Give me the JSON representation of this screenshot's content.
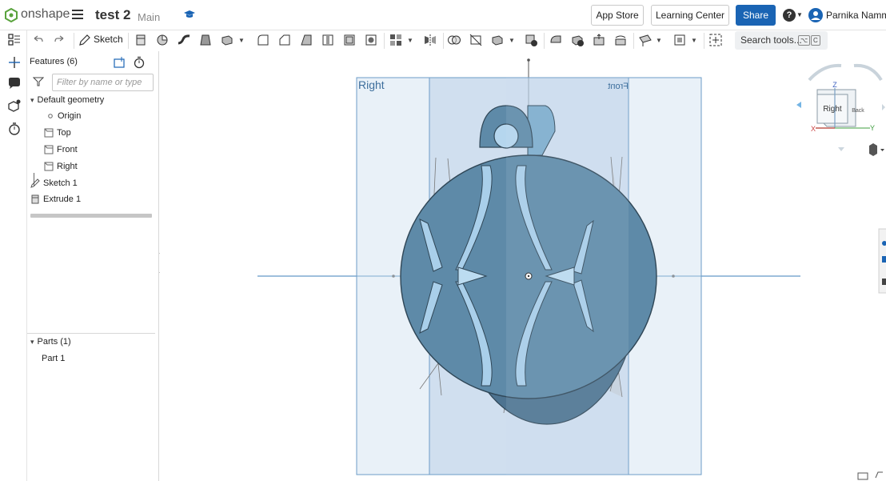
{
  "app": {
    "brand": "onshape",
    "document_title": "test 2",
    "branch": "Main"
  },
  "header": {
    "app_store": "App Store",
    "learning_center": "Learning Center",
    "share": "Share",
    "help": "?",
    "user_name": "Parnika Nammi"
  },
  "toolbar": {
    "sketch_label": "Sketch",
    "search_label": "Search tools...",
    "search_key1": "⌥",
    "search_key2": "C"
  },
  "features": {
    "title": "Features (6)",
    "filter_placeholder": "Filter by name or type",
    "default_geometry": "Default geometry",
    "items": {
      "origin": "Origin",
      "top": "Top",
      "front": "Front",
      "right": "Right",
      "sketch1": "Sketch 1",
      "extrude1": "Extrude 1"
    }
  },
  "parts": {
    "title": "Parts (1)",
    "items": [
      "Part 1"
    ]
  },
  "viewport": {
    "plane_right": "Right",
    "plane_front": "Front"
  },
  "view_cube": {
    "face_main": "Right",
    "face_side": "Back",
    "axis_z": "Z",
    "axis_x": "X",
    "axis_y": "Y"
  },
  "colors": {
    "accent": "#1a64b4",
    "part_body": "#5e8aa8",
    "part_edge": "#3a4f60",
    "plane": "#cfe0ef"
  }
}
